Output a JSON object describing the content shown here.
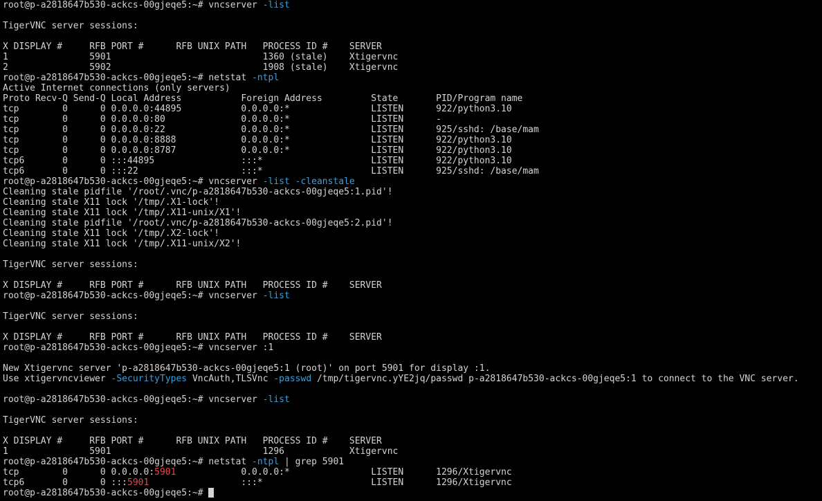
{
  "terminal": {
    "lines": [
      [
        {
          "t": "root@p-a2818647b530-ackcs-00gjeqe5:~# vncserver "
        },
        {
          "t": "-list",
          "c": "opt"
        }
      ],
      [
        {
          "t": ""
        }
      ],
      [
        {
          "t": "TigerVNC server sessions:"
        }
      ],
      [
        {
          "t": ""
        }
      ],
      [
        {
          "t": "X DISPLAY #     RFB PORT #      RFB UNIX PATH   PROCESS ID #    SERVER"
        }
      ],
      [
        {
          "t": "1               5901                            1360 (stale)    Xtigervnc"
        }
      ],
      [
        {
          "t": "2               5902                            1908 (stale)    Xtigervnc"
        }
      ],
      [
        {
          "t": "root@p-a2818647b530-ackcs-00gjeqe5:~# netstat "
        },
        {
          "t": "-ntpl",
          "c": "opt"
        }
      ],
      [
        {
          "t": "Active Internet connections (only servers)"
        }
      ],
      [
        {
          "t": "Proto Recv-Q Send-Q Local Address           Foreign Address         State       PID/Program name"
        }
      ],
      [
        {
          "t": "tcp        0      0 0.0.0.0:44895           0.0.0.0:*               LISTEN      922/python3.10"
        }
      ],
      [
        {
          "t": "tcp        0      0 0.0.0.0:80              0.0.0.0:*               LISTEN      -"
        }
      ],
      [
        {
          "t": "tcp        0      0 0.0.0.0:22              0.0.0.0:*               LISTEN      925/sshd: /base/mam"
        }
      ],
      [
        {
          "t": "tcp        0      0 0.0.0.0:8888            0.0.0.0:*               LISTEN      922/python3.10"
        }
      ],
      [
        {
          "t": "tcp        0      0 0.0.0.0:8787            0.0.0.0:*               LISTEN      922/python3.10"
        }
      ],
      [
        {
          "t": "tcp6       0      0 :::44895                :::*                    LISTEN      922/python3.10"
        }
      ],
      [
        {
          "t": "tcp6       0      0 :::22                   :::*                    LISTEN      925/sshd: /base/mam"
        }
      ],
      [
        {
          "t": "root@p-a2818647b530-ackcs-00gjeqe5:~# vncserver "
        },
        {
          "t": "-list -cleanstale",
          "c": "opt"
        }
      ],
      [
        {
          "t": "Cleaning stale pidfile '/root/.vnc/p-a2818647b530-ackcs-00gjeqe5:1.pid'!"
        }
      ],
      [
        {
          "t": "Cleaning stale X11 lock '/tmp/.X1-lock'!"
        }
      ],
      [
        {
          "t": "Cleaning stale X11 lock '/tmp/.X11-unix/X1'!"
        }
      ],
      [
        {
          "t": "Cleaning stale pidfile '/root/.vnc/p-a2818647b530-ackcs-00gjeqe5:2.pid'!"
        }
      ],
      [
        {
          "t": "Cleaning stale X11 lock '/tmp/.X2-lock'!"
        }
      ],
      [
        {
          "t": "Cleaning stale X11 lock '/tmp/.X11-unix/X2'!"
        }
      ],
      [
        {
          "t": ""
        }
      ],
      [
        {
          "t": "TigerVNC server sessions:"
        }
      ],
      [
        {
          "t": ""
        }
      ],
      [
        {
          "t": "X DISPLAY #     RFB PORT #      RFB UNIX PATH   PROCESS ID #    SERVER"
        }
      ],
      [
        {
          "t": "root@p-a2818647b530-ackcs-00gjeqe5:~# vncserver "
        },
        {
          "t": "-list",
          "c": "opt"
        }
      ],
      [
        {
          "t": ""
        }
      ],
      [
        {
          "t": "TigerVNC server sessions:"
        }
      ],
      [
        {
          "t": ""
        }
      ],
      [
        {
          "t": "X DISPLAY #     RFB PORT #      RFB UNIX PATH   PROCESS ID #    SERVER"
        }
      ],
      [
        {
          "t": "root@p-a2818647b530-ackcs-00gjeqe5:~# vncserver :1"
        }
      ],
      [
        {
          "t": ""
        }
      ],
      [
        {
          "t": "New Xtigervnc server 'p-a2818647b530-ackcs-00gjeqe5:1 (root)' on port 5901 for display :1."
        }
      ],
      [
        {
          "t": "Use xtigervncviewer "
        },
        {
          "t": "-SecurityTypes",
          "c": "opt"
        },
        {
          "t": " VncAuth,TLSVnc "
        },
        {
          "t": "-passwd",
          "c": "opt"
        },
        {
          "t": " /tmp/tigervnc.yYE2jq/passwd p-a2818647b530-ackcs-00gjeqe5:1 to connect to the VNC server."
        }
      ],
      [
        {
          "t": ""
        }
      ],
      [
        {
          "t": "root@p-a2818647b530-ackcs-00gjeqe5:~# vncserver "
        },
        {
          "t": "-list",
          "c": "opt"
        }
      ],
      [
        {
          "t": ""
        }
      ],
      [
        {
          "t": "TigerVNC server sessions:"
        }
      ],
      [
        {
          "t": ""
        }
      ],
      [
        {
          "t": "X DISPLAY #     RFB PORT #      RFB UNIX PATH   PROCESS ID #    SERVER"
        }
      ],
      [
        {
          "t": "1               5901                            1296            Xtigervnc"
        }
      ],
      [
        {
          "t": "root@p-a2818647b530-ackcs-00gjeqe5:~# netstat "
        },
        {
          "t": "-ntpl",
          "c": "opt"
        },
        {
          "t": " | grep 5901"
        }
      ],
      [
        {
          "t": "tcp        0      0 0.0.0.0:"
        },
        {
          "t": "5901",
          "c": "hl"
        },
        {
          "t": "            0.0.0.0:*               LISTEN      1296/Xtigervnc"
        }
      ],
      [
        {
          "t": "tcp6       0      0 :::"
        },
        {
          "t": "5901",
          "c": "hl"
        },
        {
          "t": "                 :::*                    LISTEN      1296/Xtigervnc"
        }
      ],
      [
        {
          "t": "root@p-a2818647b530-ackcs-00gjeqe5:~# "
        },
        {
          "cursor": true
        }
      ]
    ]
  }
}
